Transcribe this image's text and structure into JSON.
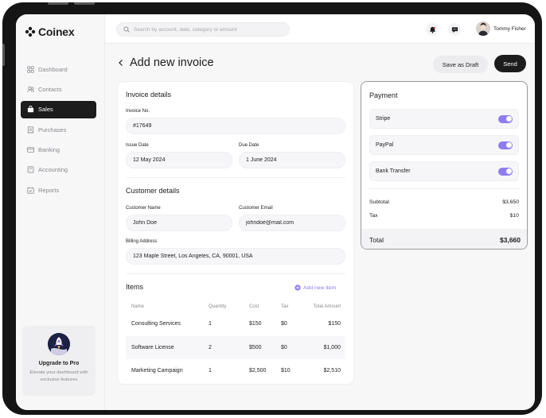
{
  "app": {
    "brand": "Coinex"
  },
  "sidebar": {
    "items": [
      {
        "label": "Dashboard",
        "icon": "grid-icon"
      },
      {
        "label": "Contacts",
        "icon": "users-icon"
      },
      {
        "label": "Sales",
        "icon": "bag-icon",
        "active": true
      },
      {
        "label": "Purchases",
        "icon": "receipt-icon"
      },
      {
        "label": "Banking",
        "icon": "card-icon"
      },
      {
        "label": "Accounting",
        "icon": "calculator-icon"
      },
      {
        "label": "Reports",
        "icon": "calendar-report-icon"
      }
    ],
    "upgrade": {
      "title": "Upgrade to Pro",
      "description": "Elevate your dashboard with exclusive features"
    }
  },
  "topbar": {
    "search_placeholder": "Search by account, date, category or amount",
    "user_name": "Tommy Fisher"
  },
  "header": {
    "title": "Add new invoice",
    "draft_label": "Save as Draft",
    "send_label": "Send"
  },
  "invoice": {
    "section_title": "Invoice details",
    "number_label": "Invoice No.",
    "number_value": "#17649",
    "issue_label": "Issue Date",
    "issue_value": "12 May 2024",
    "due_label": "Due Date",
    "due_value": "1 June 2024"
  },
  "customer": {
    "section_title": "Customer details",
    "name_label": "Customer Name",
    "name_value": "John Doe",
    "email_label": "Customer Email",
    "email_value": "johndoe@mail.com",
    "address_label": "Billing Address",
    "address_value": "123 Maple Street, Los Angeles, CA, 90001, USA"
  },
  "items": {
    "section_title": "Items",
    "add_label": "Add new item",
    "columns": [
      "Name",
      "Quantity",
      "Cost",
      "Tax",
      "Total Amount"
    ],
    "rows": [
      [
        "Consulting Services",
        "1",
        "$150",
        "$0",
        "$150"
      ],
      [
        "Software License",
        "2",
        "$500",
        "$0",
        "$1,000"
      ],
      [
        "Marketing Campaign",
        "1",
        "$2,500",
        "$10",
        "$2,510"
      ]
    ]
  },
  "payment": {
    "title": "Payment",
    "methods": [
      {
        "label": "Stripe",
        "enabled": true
      },
      {
        "label": "PayPal",
        "enabled": true
      },
      {
        "label": "Bank Transfer",
        "enabled": true
      }
    ],
    "subtotal_label": "Subtotal",
    "subtotal_value": "$3,650",
    "tax_label": "Tax",
    "tax_value": "$10",
    "total_label": "Total",
    "total_value": "$3,660"
  },
  "colors": {
    "accent": "#8e7cf0",
    "dark": "#1c1c1c",
    "background": "#f7f7f8"
  }
}
